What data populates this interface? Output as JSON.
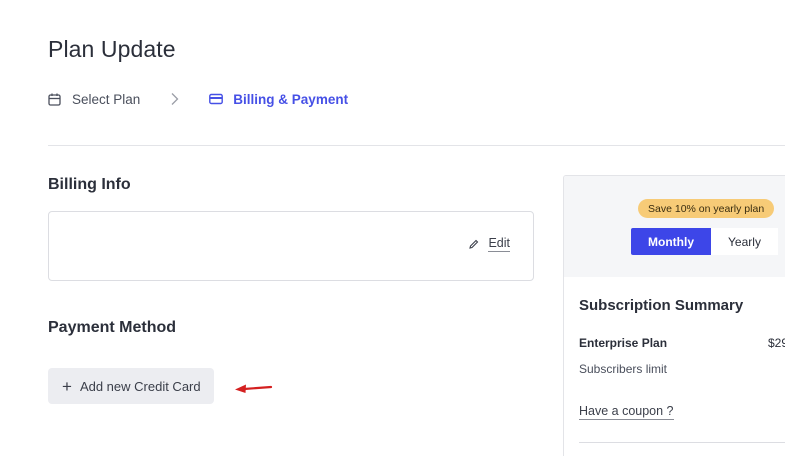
{
  "page": {
    "title": "Plan Update"
  },
  "steps": [
    {
      "label": "Select Plan",
      "icon": "calendar-icon",
      "active": false
    },
    {
      "label": "Billing & Payment",
      "icon": "credit-card-icon",
      "active": true
    }
  ],
  "billing": {
    "title": "Billing Info",
    "edit_label": "Edit"
  },
  "payment": {
    "title": "Payment Method",
    "add_card_label": "Add new Credit Card"
  },
  "summary": {
    "save_badge": "Save 10% on yearly plan",
    "toggle": {
      "monthly": "Monthly",
      "yearly": "Yearly",
      "selected": "Monthly"
    },
    "title": "Subscription Summary",
    "plan_name": "Enterprise Plan",
    "plan_price": "$29",
    "subscribers_label": "Subscribers limit",
    "coupon_label": "Have a coupon ?"
  },
  "colors": {
    "accent": "#3d46e8",
    "badge": "#f7cb77",
    "arrow": "#d42020"
  }
}
